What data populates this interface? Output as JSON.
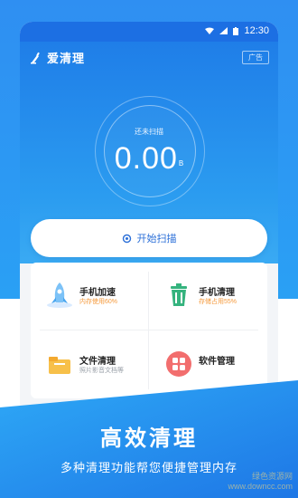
{
  "status_bar": {
    "time": "12:30"
  },
  "app": {
    "title": "爱清理",
    "ad_label": "广告"
  },
  "scan": {
    "status": "还未扫描",
    "value": "0.00",
    "unit": "B"
  },
  "scan_button": {
    "label": "开始扫描"
  },
  "tools": [
    {
      "title": "手机加速",
      "subtitle": "内存使用60%",
      "icon": "rocket-icon"
    },
    {
      "title": "手机清理",
      "subtitle": "存储占用55%",
      "icon": "trash-icon"
    },
    {
      "title": "文件清理",
      "subtitle": "照片影音文档等",
      "icon": "folder-icon"
    },
    {
      "title": "软件管理",
      "subtitle": "",
      "icon": "apps-icon"
    }
  ],
  "promo": {
    "title": "高效清理",
    "subtitle": "多种清理功能帮您便捷管理内存"
  },
  "watermark": {
    "line1": "绿色资源网",
    "line2": "www.downcc.com"
  },
  "colors": {
    "accent": "#1f7ee8",
    "orange": "#f59a3c",
    "green": "#35b37e"
  }
}
